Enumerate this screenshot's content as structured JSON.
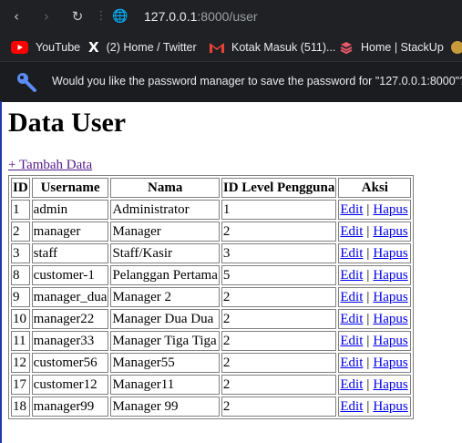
{
  "browser": {
    "url_host": "127.0.0.1",
    "url_rest": ":8000/user",
    "bookmarks": [
      {
        "label": "YouTube",
        "icon": "youtube-icon"
      },
      {
        "label": "(2) Home / Twitter",
        "icon": "x-icon"
      },
      {
        "label": "Kotak Masuk (511)...",
        "icon": "gmail-icon"
      },
      {
        "label": "Home | StackUp",
        "icon": "stackup-icon"
      }
    ],
    "password_prompt": "Would you like the password manager to save the password for \"127.0.0.1:8000\"?"
  },
  "page": {
    "title": "Data User",
    "add_link": "+ Tambah Data",
    "headers": [
      "ID",
      "Username",
      "Nama",
      "ID Level Pengguna",
      "Aksi"
    ],
    "edit_label": "Edit",
    "separator": "|",
    "delete_label": "Hapus",
    "rows": [
      {
        "id": "1",
        "username": "admin",
        "nama": "Administrator",
        "level": "1"
      },
      {
        "id": "2",
        "username": "manager",
        "nama": "Manager",
        "level": "2"
      },
      {
        "id": "3",
        "username": "staff",
        "nama": "Staff/Kasir",
        "level": "3"
      },
      {
        "id": "8",
        "username": "customer-1",
        "nama": "Pelanggan Pertama",
        "level": "5"
      },
      {
        "id": "9",
        "username": "manager_dua",
        "nama": "Manager 2",
        "level": "2"
      },
      {
        "id": "10",
        "username": "manager22",
        "nama": "Manager Dua Dua",
        "level": "2"
      },
      {
        "id": "11",
        "username": "manager33",
        "nama": "Manager Tiga Tiga",
        "level": "2"
      },
      {
        "id": "12",
        "username": "customer56",
        "nama": "Manager55",
        "level": "2"
      },
      {
        "id": "17",
        "username": "customer12",
        "nama": "Manager11",
        "level": "2"
      },
      {
        "id": "18",
        "username": "manager99",
        "nama": "Manager 99",
        "level": "2"
      }
    ]
  }
}
